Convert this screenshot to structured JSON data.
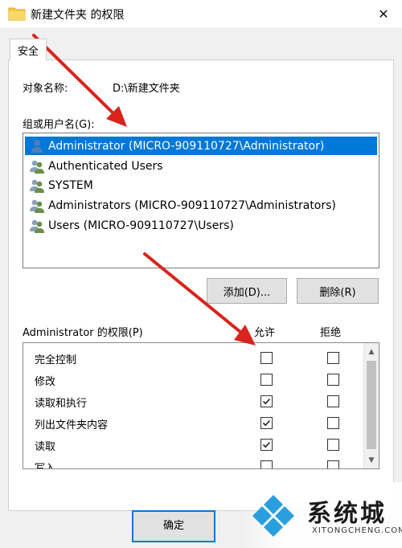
{
  "window": {
    "title": "新建文件夹 的权限",
    "close_glyph": "✕"
  },
  "tabs": [
    {
      "label": "安全"
    }
  ],
  "object": {
    "label": "对象名称:",
    "value": "D:\\新建文件夹"
  },
  "groups": {
    "label": "组或用户名(G):",
    "items": [
      {
        "name": "Administrator (MICRO-909110727\\Administrator)",
        "selected": true,
        "icon": "single-user-icon"
      },
      {
        "name": "Authenticated Users",
        "selected": false,
        "icon": "group-users-icon"
      },
      {
        "name": "SYSTEM",
        "selected": false,
        "icon": "group-users-icon"
      },
      {
        "name": "Administrators (MICRO-909110727\\Administrators)",
        "selected": false,
        "icon": "group-users-icon"
      },
      {
        "name": "Users (MICRO-909110727\\Users)",
        "selected": false,
        "icon": "group-users-icon"
      }
    ]
  },
  "buttons": {
    "add": "添加(D)...",
    "remove": "删除(R)",
    "ok": "确定"
  },
  "permissions": {
    "label": "Administrator 的权限(P)",
    "allow_header": "允许",
    "deny_header": "拒绝",
    "rows": [
      {
        "name": "完全控制",
        "allow": false,
        "deny": false
      },
      {
        "name": "修改",
        "allow": false,
        "deny": false
      },
      {
        "name": "读取和执行",
        "allow": true,
        "deny": false
      },
      {
        "name": "列出文件夹内容",
        "allow": true,
        "deny": false
      },
      {
        "name": "读取",
        "allow": true,
        "deny": false
      },
      {
        "name": "写入",
        "allow": false,
        "deny": false
      }
    ]
  },
  "watermark": {
    "text": "系统城",
    "sub": "XITONGCHENG.COM"
  },
  "colors": {
    "selection": "#0078d7",
    "annotation_arrow": "#d9241c"
  }
}
